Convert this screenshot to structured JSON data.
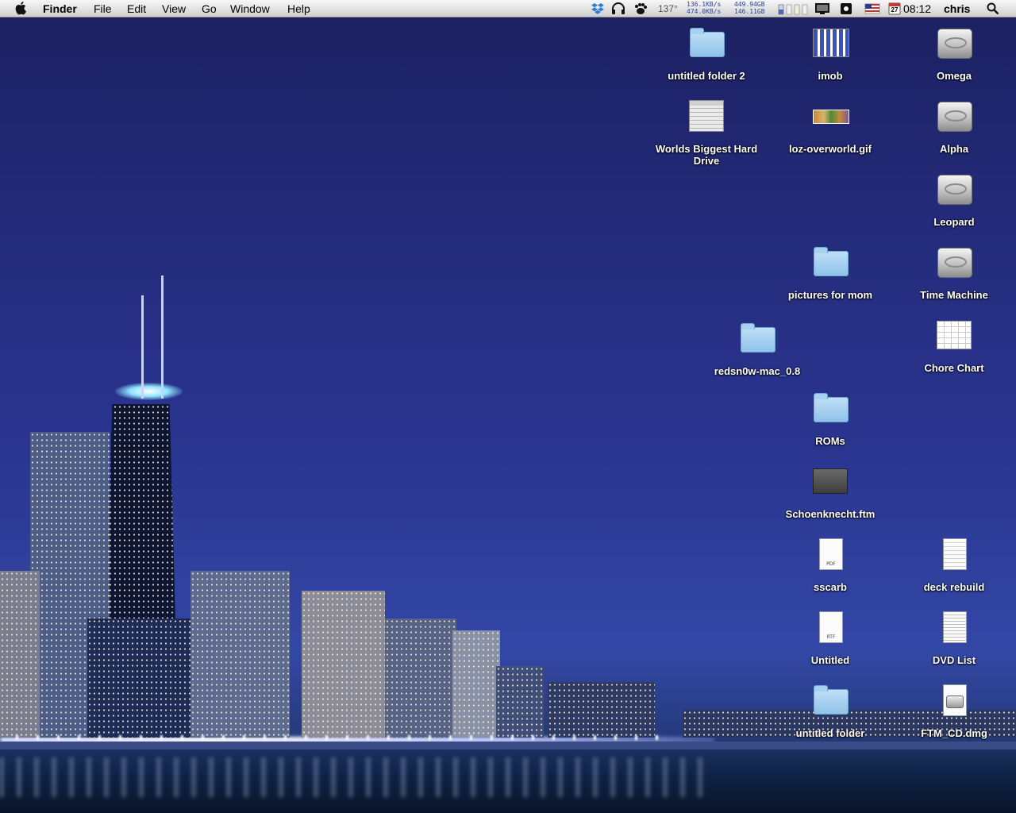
{
  "menubar": {
    "app_name": "Finder",
    "menus": [
      "File",
      "Edit",
      "View",
      "Go",
      "Window",
      "Help"
    ],
    "status": {
      "temperature": "137°",
      "net_up": "136.1KB/s",
      "net_down": "474.0KB/s",
      "disk_free_1": "449.94GB",
      "disk_free_2": "146.11GB",
      "calendar_day": "27",
      "time": "08:12",
      "user": "chris"
    }
  },
  "desktop_icons": {
    "untitled_folder_2": "untitled folder 2",
    "imob": "imob",
    "omega": "Omega",
    "worlds_biggest": "Worlds Biggest Hard Drive",
    "loz": "loz-overworld.gif",
    "alpha": "Alpha",
    "leopard": "Leopard",
    "pictures_for_mom": "pictures for mom",
    "time_machine": "Time Machine",
    "redsn0w": "redsn0w-mac_0.8",
    "chore_chart": "Chore Chart",
    "roms": "ROMs",
    "schoenknecht": "Schoenknecht.ftm",
    "sscarb": "sscarb",
    "deck_rebuild": "deck rebuild",
    "untitled": "Untitled",
    "dvd_list": "DVD List",
    "untitled_folder": "untitled folder",
    "ftm_cd": "FTM_CD.dmg"
  },
  "doc_tags": {
    "pdf": "PDF",
    "rtf": "RTF"
  }
}
